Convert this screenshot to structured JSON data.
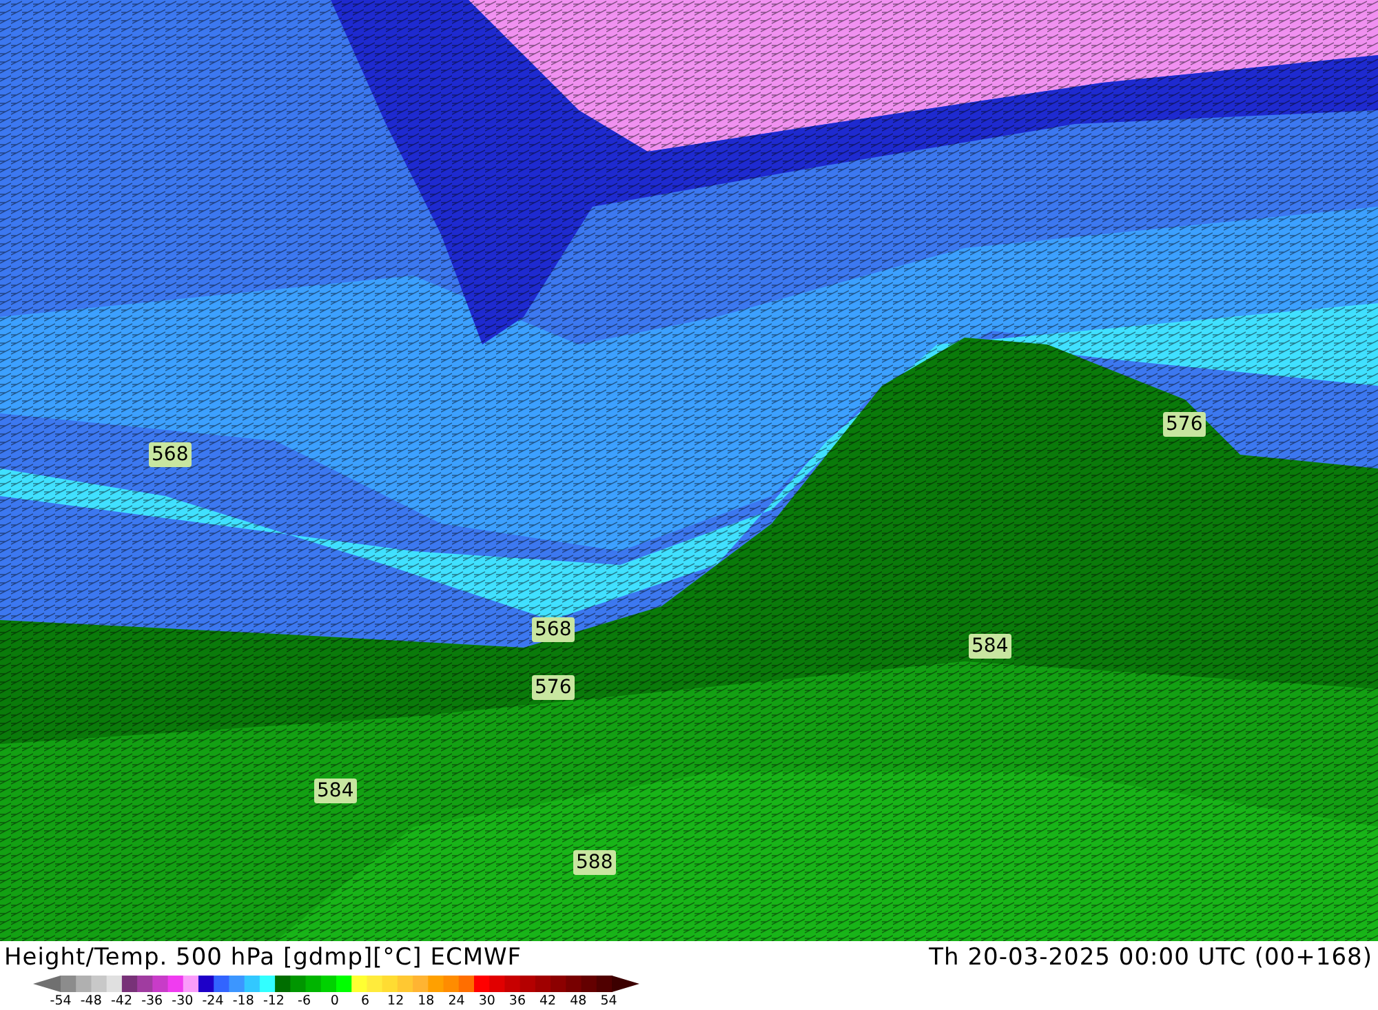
{
  "map": {
    "contour_labels": [
      {
        "text": "568"
      },
      {
        "text": "576"
      },
      {
        "text": "568"
      },
      {
        "text": "584"
      },
      {
        "text": "576"
      },
      {
        "text": "584"
      },
      {
        "text": "588"
      }
    ]
  },
  "footer": {
    "title": "Height/Temp. 500 hPa [gdmp][°C] ECMWF",
    "valid_time": "Th 20-03-2025 00:00 UTC (00+168)",
    "colorbar": {
      "ticks": [
        "-54",
        "-48",
        "-42",
        "-36",
        "-30",
        "-24",
        "-18",
        "-12",
        "-6",
        "0",
        "6",
        "12",
        "18",
        "24",
        "30",
        "36",
        "42",
        "48",
        "54"
      ]
    }
  }
}
